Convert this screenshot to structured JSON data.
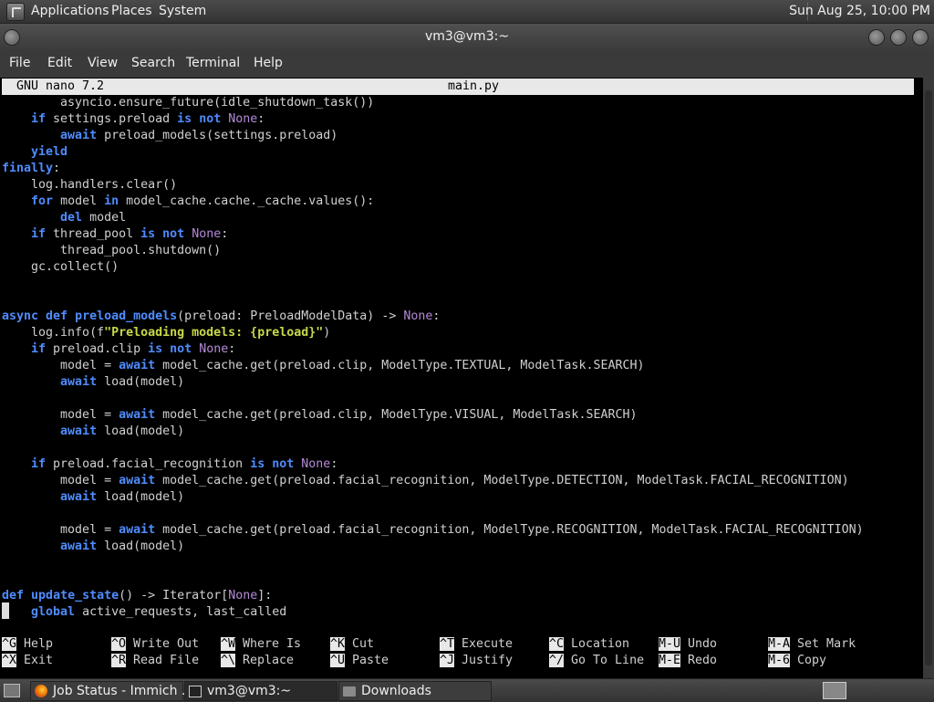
{
  "top_panel": {
    "menus": [
      "Applications",
      "Places",
      "System"
    ],
    "clock": "Sun Aug 25, 10:00 PM"
  },
  "window": {
    "title": "vm3@vm3:~"
  },
  "menubar": [
    "File",
    "Edit",
    "View",
    "Search",
    "Terminal",
    "Help"
  ],
  "nano": {
    "version": "GNU nano 7.2",
    "filename": "main.py",
    "code_lines": [
      "        asyncio.ensure_future(idle_shutdown_task())",
      "    if settings.preload is not None:",
      "        await preload_models(settings.preload)",
      "    yield",
      "finally:",
      "    log.handlers.clear()",
      "    for model in model_cache.cache._cache.values():",
      "        del model",
      "    if thread_pool is not None:",
      "        thread_pool.shutdown()",
      "    gc.collect()",
      "",
      "",
      "async def preload_models(preload: PreloadModelData) -> None:",
      "    log.info(f\"Preloading models: {preload}\")",
      "    if preload.clip is not None:",
      "        model = await model_cache.get(preload.clip, ModelType.TEXTUAL, ModelTask.SEARCH)",
      "        await load(model)",
      "",
      "        model = await model_cache.get(preload.clip, ModelType.VISUAL, ModelTask.SEARCH)",
      "        await load(model)",
      "",
      "    if preload.facial_recognition is not None:",
      "        model = await model_cache.get(preload.facial_recognition, ModelType.DETECTION, ModelTask.FACIAL_RECOGNITION)",
      "        await load(model)",
      "",
      "        model = await model_cache.get(preload.facial_recognition, ModelType.RECOGNITION, ModelTask.FACIAL_RECOGNITION)",
      "        await load(model)",
      "",
      "",
      "def update_state() -> Iterator[None]:",
      "    global active_requests, last_called"
    ],
    "shortcuts": [
      [
        {
          "key": "^G",
          "label": "Help"
        },
        {
          "key": "^X",
          "label": "Exit"
        }
      ],
      [
        {
          "key": "^O",
          "label": "Write Out"
        },
        {
          "key": "^R",
          "label": "Read File"
        }
      ],
      [
        {
          "key": "^W",
          "label": "Where Is"
        },
        {
          "key": "^\\",
          "label": "Replace"
        }
      ],
      [
        {
          "key": "^K",
          "label": "Cut"
        },
        {
          "key": "^U",
          "label": "Paste"
        }
      ],
      [
        {
          "key": "^T",
          "label": "Execute"
        },
        {
          "key": "^J",
          "label": "Justify"
        }
      ],
      [
        {
          "key": "^C",
          "label": "Location"
        },
        {
          "key": "^/",
          "label": "Go To Line"
        }
      ],
      [
        {
          "key": "M-U",
          "label": "Undo"
        },
        {
          "key": "M-E",
          "label": "Redo"
        }
      ],
      [
        {
          "key": "M-A",
          "label": "Set Mark"
        },
        {
          "key": "M-6",
          "label": "Copy"
        }
      ]
    ]
  },
  "taskbar": {
    "tasks": [
      {
        "label": "Job Status - Immich ...",
        "icon": "firefox-icon"
      },
      {
        "label": "vm3@vm3:~",
        "icon": "terminal-icon"
      },
      {
        "label": "Downloads",
        "icon": "folder-icon"
      }
    ]
  }
}
